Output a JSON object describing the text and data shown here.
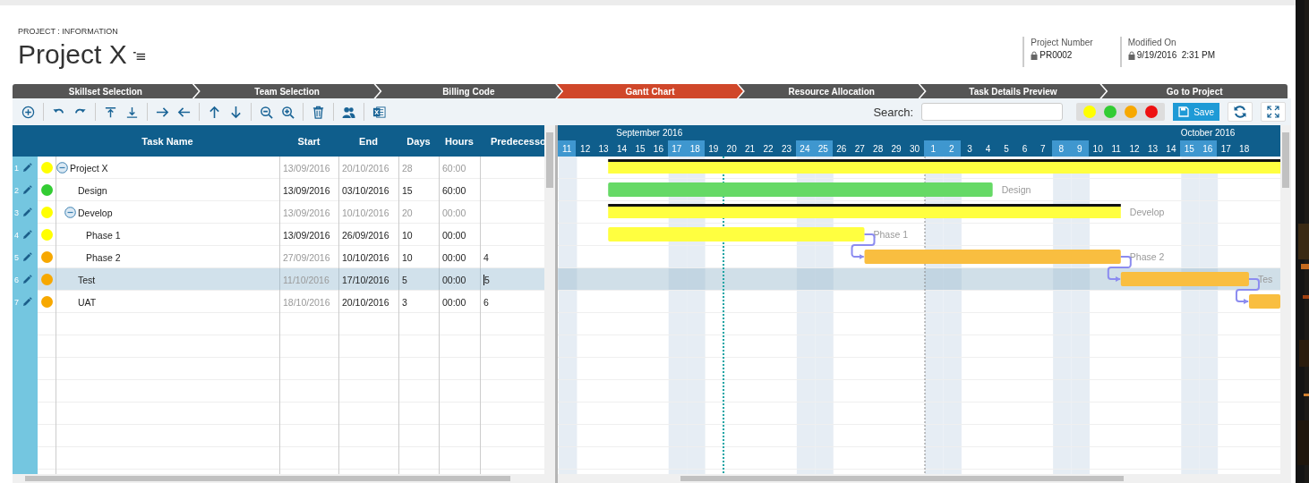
{
  "breadcrumb": "PROJECT : INFORMATION",
  "title": "Project X",
  "header_fields": [
    {
      "label": "Project Number",
      "value": "PR0002",
      "locked": true
    },
    {
      "label": "Modified On",
      "value": "9/19/2016  2:31 PM",
      "locked": true
    }
  ],
  "steps": [
    {
      "label": "Skillset Selection",
      "selected": false
    },
    {
      "label": "Team Selection",
      "selected": false
    },
    {
      "label": "Billing Code",
      "selected": false
    },
    {
      "label": "Gantt Chart",
      "selected": true
    },
    {
      "label": "Resource Allocation",
      "selected": false
    },
    {
      "label": "Task Details Preview",
      "selected": false
    },
    {
      "label": "Go to Project",
      "selected": false
    }
  ],
  "toolbar": {
    "search_label": "Search:",
    "save_label": "Save",
    "color_filters": [
      {
        "color": "#ffff00"
      },
      {
        "color": "#33cc33"
      },
      {
        "color": "#f7a800"
      },
      {
        "color": "#ee1111"
      }
    ]
  },
  "columns": [
    "Task Name",
    "Start",
    "End",
    "Days",
    "Hours",
    "Predecesso"
  ],
  "tasks": [
    {
      "num": "1",
      "name": "Project X",
      "kind": "summary",
      "color": "#ffff00",
      "expanded": true,
      "selected": false,
      "editing": false,
      "start": "13/09/2016",
      "end": "20/10/2016",
      "days": "28",
      "hours": "60:00",
      "children": [
        {
          "num": "2",
          "name": "Design",
          "kind": "task",
          "color": "#33cc33",
          "selected": false,
          "editing": false,
          "start_auto": false,
          "start": "13/09/2016",
          "end": "03/10/2016",
          "days": "15",
          "hours": "60:00",
          "bar_label": "Design"
        },
        {
          "num": "3",
          "name": "Develop",
          "kind": "summary",
          "color": "#ffff00",
          "expanded": true,
          "selected": false,
          "editing": false,
          "start": "13/09/2016",
          "end": "10/10/2016",
          "days": "20",
          "hours": "00:00",
          "bar_label": "Develop",
          "children": [
            {
              "num": "4",
              "name": "Phase 1",
              "kind": "task",
              "color": "#ffff00",
              "selected": false,
              "editing": false,
              "start_auto": false,
              "start": "13/09/2016",
              "end": "26/09/2016",
              "days": "10",
              "hours": "00:00",
              "bar_label": "Phase 1"
            },
            {
              "num": "5",
              "name": "Phase 2",
              "kind": "task",
              "color": "#f7a800",
              "selected": false,
              "editing": false,
              "start_auto": true,
              "start": "27/09/2016",
              "end": "10/10/2016",
              "days": "10",
              "hours": "00:00",
              "predecessor": "4",
              "bar_label": "Phase 2"
            }
          ]
        },
        {
          "num": "6",
          "name": "Test",
          "kind": "task",
          "color": "#f7a800",
          "selected": true,
          "editing": true,
          "start_auto": true,
          "start": "11/10/2016",
          "end": "17/10/2016",
          "days": "5",
          "hours": "00:00",
          "predecessor": "5",
          "bar_label": "Tes"
        },
        {
          "num": "7",
          "name": "UAT",
          "kind": "task",
          "color": "#f7a800",
          "selected": false,
          "editing": false,
          "start_auto": true,
          "start": "18/10/2016",
          "end": "20/10/2016",
          "days": "3",
          "hours": "00:00",
          "predecessor": "6"
        }
      ]
    }
  ],
  "timeline": {
    "months": [
      {
        "label": "September 2016",
        "days": [
          {
            "label": "11",
            "weekend": true
          },
          {
            "label": "12",
            "weekend": false
          },
          {
            "label": "13",
            "weekend": false
          },
          {
            "label": "14",
            "weekend": false
          },
          {
            "label": "15",
            "weekend": false
          },
          {
            "label": "16",
            "weekend": false
          },
          {
            "label": "17",
            "weekend": true
          },
          {
            "label": "18",
            "weekend": true
          },
          {
            "label": "19",
            "weekend": false,
            "today": true
          },
          {
            "label": "20",
            "weekend": false
          },
          {
            "label": "21",
            "weekend": false
          },
          {
            "label": "22",
            "weekend": false
          },
          {
            "label": "23",
            "weekend": false
          },
          {
            "label": "24",
            "weekend": true
          },
          {
            "label": "25",
            "weekend": true
          },
          {
            "label": "26",
            "weekend": false
          },
          {
            "label": "27",
            "weekend": false
          },
          {
            "label": "28",
            "weekend": false
          },
          {
            "label": "29",
            "weekend": false
          },
          {
            "label": "30",
            "weekend": false
          }
        ]
      },
      {
        "label": "October 2016",
        "days": [
          {
            "label": "1",
            "weekend": true
          },
          {
            "label": "2",
            "weekend": true
          },
          {
            "label": "3",
            "weekend": false
          },
          {
            "label": "4",
            "weekend": false
          },
          {
            "label": "5",
            "weekend": false
          },
          {
            "label": "6",
            "weekend": false
          },
          {
            "label": "7",
            "weekend": false
          },
          {
            "label": "8",
            "weekend": true
          },
          {
            "label": "9",
            "weekend": true
          },
          {
            "label": "10",
            "weekend": false
          },
          {
            "label": "11",
            "weekend": false
          },
          {
            "label": "12",
            "weekend": false
          },
          {
            "label": "13",
            "weekend": false
          },
          {
            "label": "14",
            "weekend": false
          },
          {
            "label": "15",
            "weekend": true
          },
          {
            "label": "16",
            "weekend": true
          },
          {
            "label": "17",
            "weekend": false
          },
          {
            "label": "18",
            "weekend": false
          }
        ]
      }
    ]
  }
}
